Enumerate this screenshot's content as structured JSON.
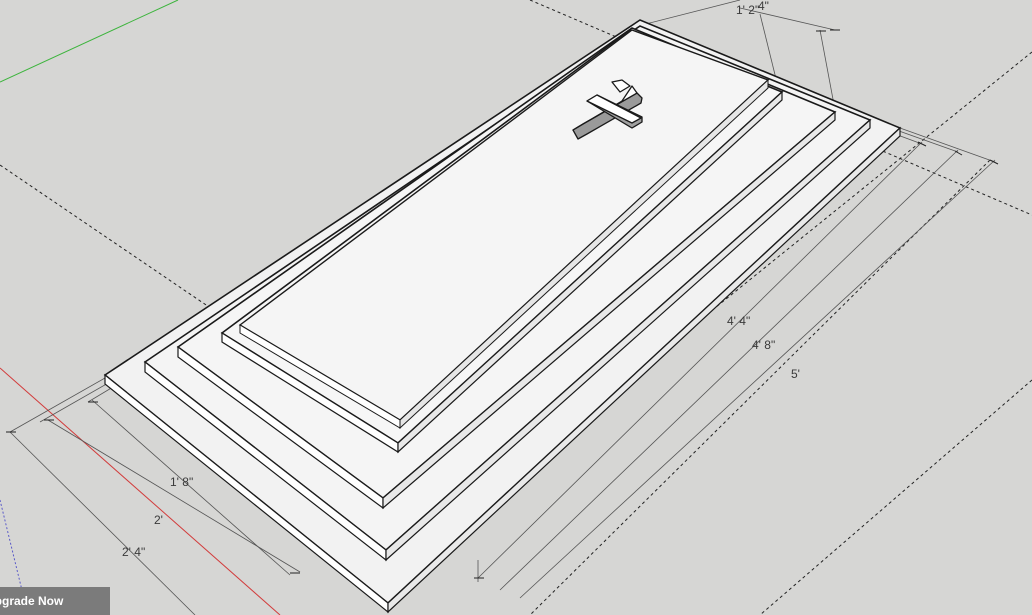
{
  "banner": {
    "upgrade_label": "Upgrade Now"
  },
  "dimensions": {
    "top_width_inner": "1' 2\"",
    "top_width_outer": "4\"",
    "length_4_4": "4' 4\"",
    "length_4_8": "4' 8\"",
    "length_5": "5'",
    "width_1_8": "1' 8\"",
    "width_2": "2'",
    "width_2_4": "2' 4\""
  },
  "colors": {
    "background": "#d6d6d4",
    "slab_face": "#f5f5f5",
    "edge": "#1a1a1a",
    "axis_green": "#3cb43c",
    "axis_red": "#d23c3c",
    "axis_blue": "#5a5ac8",
    "banner": "#7b7b7b"
  },
  "scene": {
    "object": "grave-slab-stack",
    "tiers": 4,
    "ornament": "cross-icon"
  }
}
